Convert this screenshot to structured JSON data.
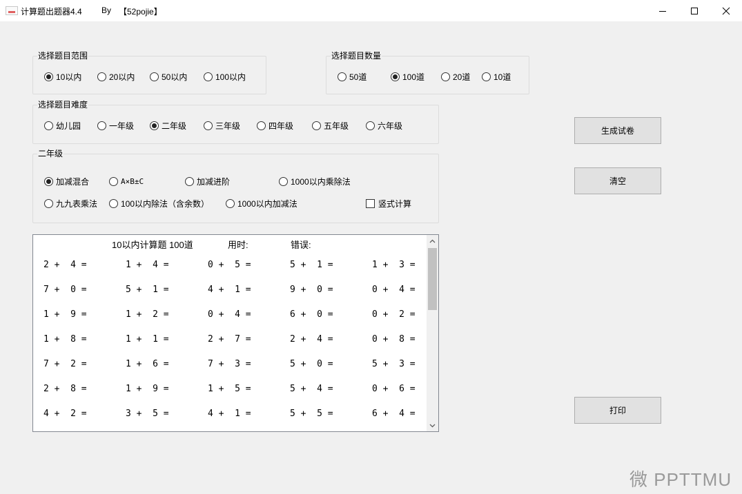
{
  "window": {
    "title": "计算题出题器4.4",
    "by": "By",
    "author": "【52pojie】",
    "minimize_icon": "minimize-icon",
    "maximize_icon": "maximize-icon",
    "close_icon": "close-icon"
  },
  "range_group": {
    "title": "选择题目范围",
    "options": [
      "10以内",
      "20以内",
      "50以内",
      "100以内"
    ],
    "selected": "10以内"
  },
  "count_group": {
    "title": "选择题目数量",
    "options": [
      "50道",
      "100道",
      "20道",
      "10道"
    ],
    "selected": "100道"
  },
  "difficulty_group": {
    "title": "选择题目难度",
    "options": [
      "幼儿园",
      "一年级",
      "二年级",
      "三年级",
      "四年级",
      "五年级",
      "六年级"
    ],
    "selected": "二年级"
  },
  "type_group": {
    "title": "二年级",
    "options": [
      "加减混合",
      "A×B±C",
      "加减进阶",
      "1000以内乘除法",
      "九九表乘法",
      "100以内除法（含余数）",
      "1000以内加减法"
    ],
    "selected": "加减混合",
    "checkbox_label": "竖式计算",
    "checkbox_checked": false
  },
  "buttons": {
    "generate": "生成试卷",
    "clear": "清空",
    "print": "打印"
  },
  "worksheet": {
    "heading": "10以内计算题 100道",
    "time_label": "用时:",
    "error_label": "错误:",
    "rows": [
      [
        "2 +  4 =",
        "1 +  4 =",
        "0 +  5 =",
        "5 +  1 =",
        "1 +  3 ="
      ],
      [
        "7 +  0 =",
        "5 +  1 =",
        "4 +  1 =",
        "9 +  0 =",
        "0 +  4 ="
      ],
      [
        "1 +  9 =",
        "1 +  2 =",
        "0 +  4 =",
        "6 +  0 =",
        "0 +  2 ="
      ],
      [
        "1 +  8 =",
        "1 +  1 =",
        "2 +  7 =",
        "2 +  4 =",
        "0 +  8 ="
      ],
      [
        "7 +  2 =",
        "1 +  6 =",
        "7 +  3 =",
        "5 +  0 =",
        "5 +  3 ="
      ],
      [
        "2 +  8 =",
        "1 +  9 =",
        "1 +  5 =",
        "5 +  4 =",
        "0 +  6 ="
      ],
      [
        "4 +  2 =",
        "3 +  5 =",
        "4 +  1 =",
        "5 +  5 =",
        "6 +  4 ="
      ]
    ]
  },
  "watermark": "微 PPTTMU"
}
